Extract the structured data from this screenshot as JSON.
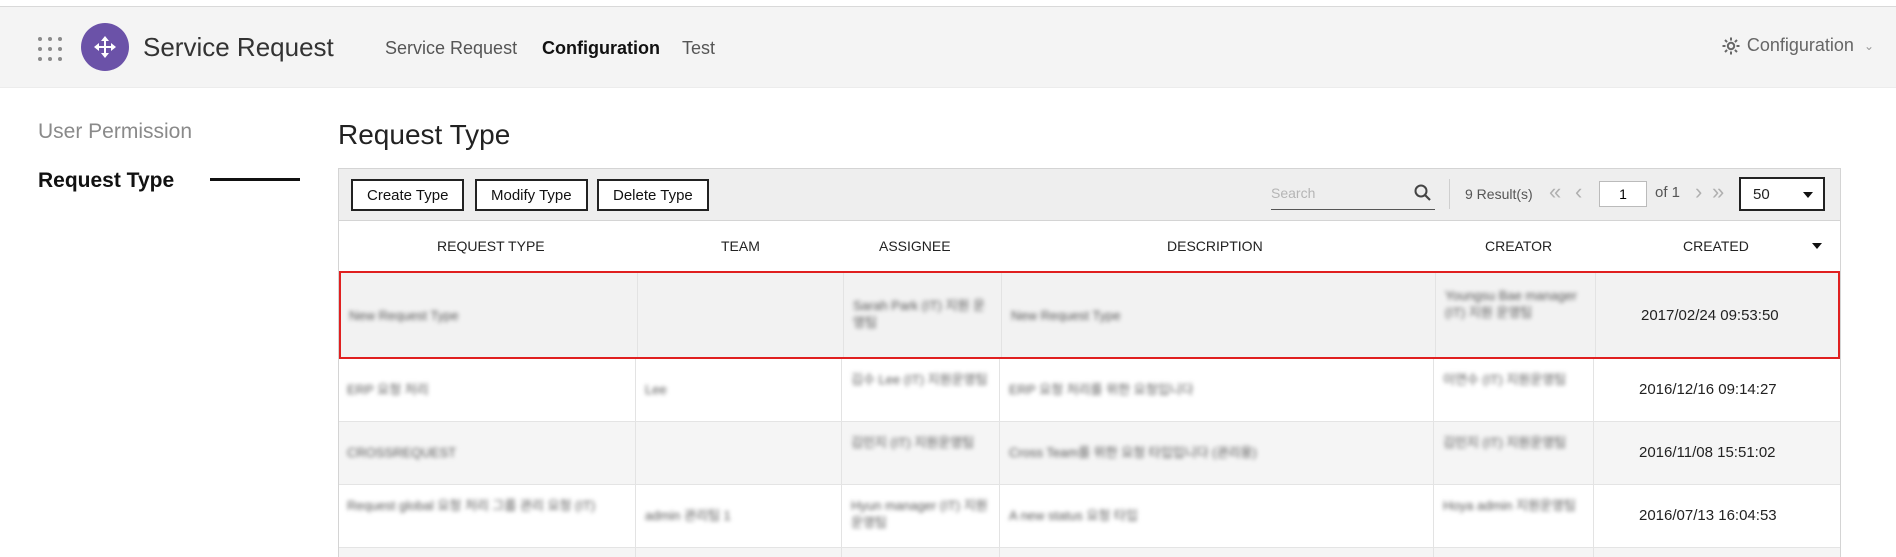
{
  "app": {
    "title": "Service Request"
  },
  "nav": {
    "items": [
      "Service Request",
      "Configuration",
      "Test"
    ],
    "active": "Configuration"
  },
  "header": {
    "config_label": "Configuration"
  },
  "sidebar": {
    "items": [
      {
        "label": "User Permission"
      },
      {
        "label": "Request Type"
      }
    ],
    "active": "Request Type"
  },
  "page": {
    "title": "Request Type"
  },
  "toolbar": {
    "create_label": "Create Type",
    "modify_label": "Modify Type",
    "delete_label": "Delete Type",
    "search_placeholder": "Search",
    "results_text": "9 Result(s)",
    "page": "1",
    "of_text": "of 1",
    "per_page": "50"
  },
  "table": {
    "columns": [
      "REQUEST TYPE",
      "TEAM",
      "ASSIGNEE",
      "DESCRIPTION",
      "CREATOR",
      "CREATED"
    ],
    "rows": [
      {
        "request_type": "New Request Type",
        "team": "",
        "assignee": "Sarah Park (IT) 지원 운영팀",
        "description": "New Request Type",
        "creator": "Youngsu Bae manager (IT) 지원 운영팀",
        "created": "2017/02/24 09:53:50",
        "selected": true
      },
      {
        "request_type": "ERP 요청 처리",
        "team": "Lee",
        "assignee": "김수 Lee (IT) 지원운영팀",
        "description": "ERP 요청 처리를 위한 요청입니다",
        "creator": "이연수 (IT) 지원운영팀",
        "created": "2016/12/16 09:14:27",
        "selected": false
      },
      {
        "request_type": "CROSSREQUEST",
        "team": "",
        "assignee": "김민지 (IT) 지원운영팀",
        "description": "Cross Team를 위한 요청 타입입니다 (관리용)",
        "creator": "김민지 (IT) 지원운영팀",
        "created": "2016/11/08 15:51:02",
        "selected": false
      },
      {
        "request_type": "Request global 요청 처리 그룹 관리 요청 (IT)",
        "team": "admin 관리팀 1",
        "assignee": "Hyun manager (IT) 지원운영팀",
        "description": "A new status 요청 타입",
        "creator": "Hoya admin 지원운영팀",
        "created": "2016/07/13 16:04:53",
        "selected": false
      }
    ]
  },
  "colors": {
    "accent": "#6b52a8",
    "selection": "#e02020"
  },
  "icons": [
    "apps-grid-icon",
    "logo-icon",
    "gear-icon",
    "search-icon",
    "first-page-icon",
    "prev-page-icon",
    "next-page-icon",
    "last-page-icon"
  ]
}
